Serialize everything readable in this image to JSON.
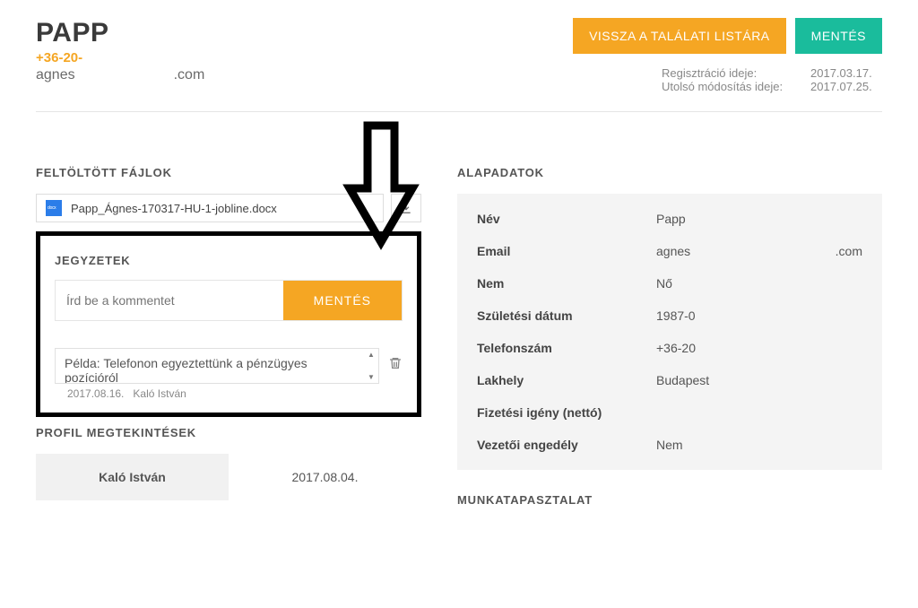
{
  "header": {
    "title": "PAPP",
    "phone": "+36-20-",
    "email_prefix": "agnes",
    "email_suffix": ".com",
    "back_btn": "VISSZA A TALÁLATI LISTÁRA",
    "save_btn": "MENTÉS",
    "reg_label": "Regisztráció ideje:",
    "reg_val": "2017.03.17.",
    "mod_label": "Utolsó módosítás ideje:",
    "mod_val": "2017.07.25."
  },
  "files": {
    "section_title": "FELTÖLTÖTT FÁJLOK",
    "filename": "Papp_Ágnes-170317-HU-1-jobline.docx"
  },
  "notes": {
    "section_title": "JEGYZETEK",
    "placeholder": "Írd be a kommentet",
    "save_btn": "MENTÉS",
    "example_text": "Példa: Telefonon egyeztettünk a pénzügyes pozícióról",
    "meta_date": "2017.08.16.",
    "meta_author": "Kaló István"
  },
  "profile_views": {
    "section_title": "PROFIL MEGTEKINTÉSEK",
    "name": "Kaló István",
    "date": "2017.08.04."
  },
  "basedata": {
    "section_title": "ALAPADATOK",
    "rows": [
      {
        "label": "Név",
        "val": "Papp",
        "suffix": ""
      },
      {
        "label": "Email",
        "val": "agnes",
        "suffix": ".com"
      },
      {
        "label": "Nem",
        "val": "Nő",
        "suffix": ""
      },
      {
        "label": "Születési dátum",
        "val": "1987-0",
        "suffix": ""
      },
      {
        "label": "Telefonszám",
        "val": "+36-20",
        "suffix": ""
      },
      {
        "label": "Lakhely",
        "val": "Budapest",
        "suffix": ""
      },
      {
        "label": "Fizetési igény (nettó)",
        "val": "",
        "suffix": ""
      },
      {
        "label": "Vezetői engedély",
        "val": "Nem",
        "suffix": ""
      }
    ]
  },
  "experience": {
    "section_title": "MUNKATAPASZTALAT"
  }
}
